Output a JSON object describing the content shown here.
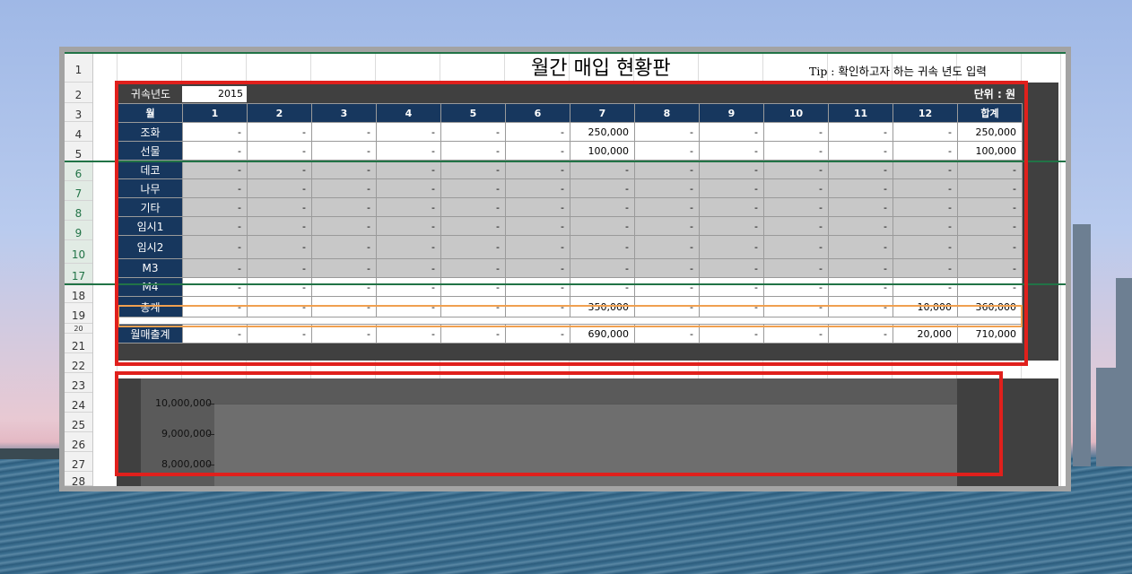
{
  "sheet": {
    "row_numbers": [
      "1",
      "2",
      "3",
      "4",
      "5",
      "6",
      "7",
      "8",
      "9",
      "10",
      "17",
      "18",
      "19",
      "20",
      "21",
      "22",
      "23",
      "24",
      "25",
      "26",
      "27",
      "28"
    ],
    "title": "월간 매입 현황판",
    "tip": "Tip : 확인하고자 하는 귀속 년도 입력",
    "year_label": "귀속년도",
    "year_value": "2015",
    "unit_label": "단위 : 원"
  },
  "table": {
    "header": [
      "월",
      "1",
      "2",
      "3",
      "4",
      "5",
      "6",
      "7",
      "8",
      "9",
      "10",
      "11",
      "12",
      "합계"
    ],
    "rows": [
      {
        "label": "조화",
        "values": [
          "-",
          "-",
          "-",
          "-",
          "-",
          "-",
          "250,000",
          "-",
          "-",
          "-",
          "-",
          "-",
          "250,000"
        ]
      },
      {
        "label": "선물",
        "values": [
          "-",
          "-",
          "-",
          "-",
          "-",
          "-",
          "100,000",
          "-",
          "-",
          "-",
          "-",
          "-",
          "100,000"
        ]
      },
      {
        "label": "데코",
        "values": [
          "-",
          "-",
          "-",
          "-",
          "-",
          "-",
          "-",
          "-",
          "-",
          "-",
          "-",
          "-",
          "-"
        ]
      },
      {
        "label": "나무",
        "values": [
          "-",
          "-",
          "-",
          "-",
          "-",
          "-",
          "-",
          "-",
          "-",
          "-",
          "-",
          "-",
          "-"
        ]
      },
      {
        "label": "기타",
        "values": [
          "-",
          "-",
          "-",
          "-",
          "-",
          "-",
          "-",
          "-",
          "-",
          "-",
          "-",
          "-",
          "-"
        ]
      },
      {
        "label": "임시1",
        "values": [
          "-",
          "-",
          "-",
          "-",
          "-",
          "-",
          "-",
          "-",
          "-",
          "-",
          "-",
          "-",
          "-"
        ]
      },
      {
        "label": "임시2",
        "values": [
          "-",
          "-",
          "-",
          "-",
          "-",
          "-",
          "-",
          "-",
          "-",
          "-",
          "-",
          "-",
          "-"
        ]
      },
      {
        "label": "M3",
        "values": [
          "-",
          "-",
          "-",
          "-",
          "-",
          "-",
          "-",
          "-",
          "-",
          "-",
          "-",
          "-",
          "-"
        ]
      },
      {
        "label": "M4",
        "values": [
          "-",
          "-",
          "-",
          "-",
          "-",
          "-",
          "-",
          "-",
          "-",
          "-",
          "-",
          "-",
          "-"
        ]
      },
      {
        "label": "총계",
        "values": [
          "-",
          "-",
          "-",
          "-",
          "-",
          "-",
          "350,000",
          "-",
          "-",
          "-",
          "-",
          "10,000",
          "360,000"
        ]
      },
      {
        "label": "월매출계",
        "values": [
          "-",
          "-",
          "-",
          "-",
          "-",
          "-",
          "690,000",
          "-",
          "-",
          "-",
          "-",
          "20,000",
          "710,000"
        ]
      }
    ]
  },
  "chart": {
    "y_ticks": [
      "10,000,000",
      "9,000,000",
      "8,000,000"
    ]
  }
}
